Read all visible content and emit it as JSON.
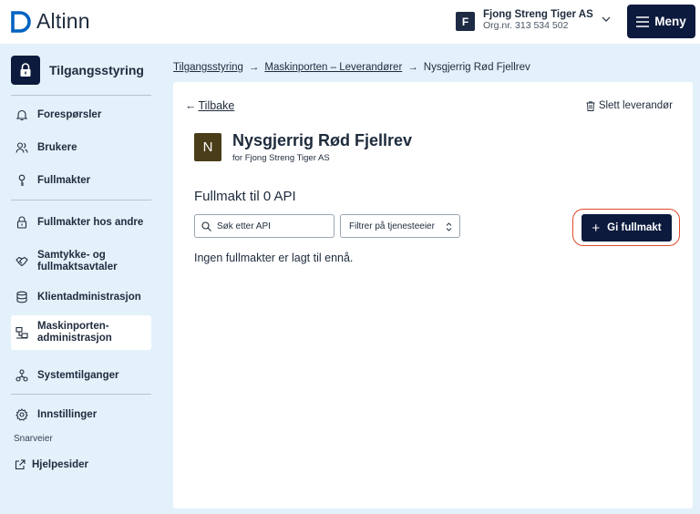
{
  "header": {
    "logo_text": "Altinn",
    "org_initial": "F",
    "org_name": "Fjong Streng Tiger AS",
    "org_number": "Org.nr. 313 534 502",
    "menu_label": "Meny"
  },
  "sidebar": {
    "title": "Tilgangsstyring",
    "items": [
      {
        "label": "Forespørsler",
        "icon": "bell-icon"
      },
      {
        "label": "Brukere",
        "icon": "users-icon"
      },
      {
        "label": "Fullmakter",
        "icon": "key-icon"
      },
      {
        "label": "Fullmakter hos andre",
        "icon": "lock-icon"
      },
      {
        "label": "Samtykke- og fullmaktsavtaler",
        "icon": "handshake-icon"
      },
      {
        "label": "Klientadministrasjon",
        "icon": "database-icon"
      },
      {
        "label": "Maskinporten-administrasjon",
        "icon": "network-icon"
      },
      {
        "label": "Systemtilganger",
        "icon": "system-access-icon"
      },
      {
        "label": "Innstillinger",
        "icon": "gear-icon"
      }
    ],
    "shortcuts_label": "Snarveier",
    "help_label": "Hjelpesider"
  },
  "breadcrumb": {
    "items": [
      "Tilgangsstyring",
      "Maskinporten – Leverandører",
      "Nysgjerrig Rød Fjellrev"
    ]
  },
  "main": {
    "back_label": "Tilbake",
    "delete_label": "Slett leverandør",
    "provider_initial": "N",
    "provider_name": "Nysgjerrig Rød Fjellrev",
    "provider_subtitle": "for Fjong Streng Tiger AS",
    "section_title": "Fullmakt til 0 API",
    "search_placeholder": "Søk etter API",
    "filter_label": "Filtrer på tjenesteeier",
    "grant_button": "Gi fullmakt",
    "empty_text": "Ingen fullmakter er lagt til ennå."
  },
  "colors": {
    "page_background": "#e3f1fb",
    "primary_dark": "#0c1a3d",
    "highlight_ring": "#e24a2b",
    "provider_avatar": "#4a3d19"
  }
}
